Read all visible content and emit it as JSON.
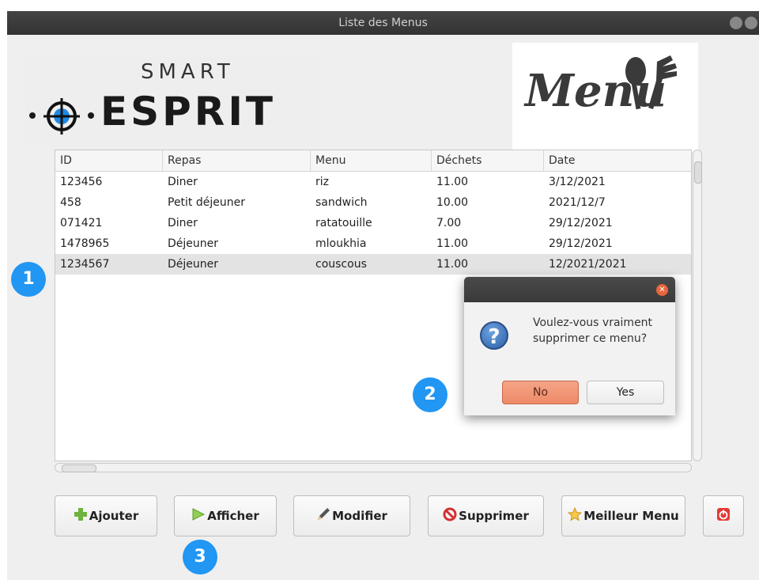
{
  "window": {
    "title": "Liste des Menus"
  },
  "logos": {
    "brand_top": "SMART",
    "brand_bottom": "ESPRIT",
    "menu": "Menu"
  },
  "table": {
    "columns": [
      "ID",
      "Repas",
      "Menu",
      "Déchets",
      "Date"
    ],
    "rows": [
      [
        "123456",
        "Diner",
        "riz",
        "11.00",
        "3/12/2021"
      ],
      [
        "458",
        "Petit déjeuner",
        "sandwich",
        "10.00",
        "2021/12/7"
      ],
      [
        "071421",
        "Diner",
        "ratatouille",
        "7.00",
        "29/12/2021"
      ],
      [
        "1478965",
        "Déjeuner",
        "mloukhia",
        "11.00",
        "29/12/2021"
      ],
      [
        "1234567",
        "Déjeuner",
        "couscous",
        "11.00",
        "12/2021/2021"
      ]
    ],
    "selected_row": 4
  },
  "buttons": {
    "ajouter": "Ajouter",
    "afficher": "Afficher",
    "modifier": "Modifier",
    "supprimer": "Supprimer",
    "meilleur": "Meilleur Menu"
  },
  "dialog": {
    "message": "Voulez-vous vraiment supprimer ce menu?",
    "no": "No",
    "yes": "Yes"
  },
  "badges": [
    "1",
    "2",
    "3"
  ],
  "colors": {
    "badge": "#2196f3",
    "no_button": "#ed8a68",
    "title_bar": "#3a3a3a"
  }
}
